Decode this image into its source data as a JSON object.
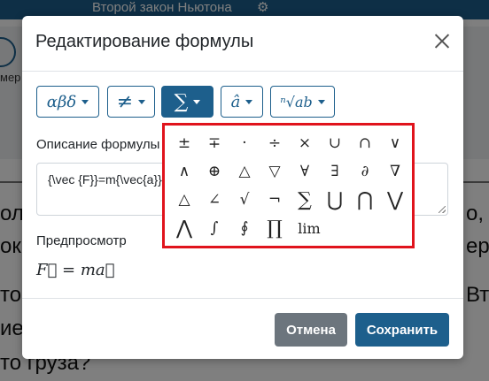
{
  "background": {
    "title": "Второй закон Ньютона",
    "side_text": "мер",
    "lines": [
      "ол",
      "ок",
      "то",
      "ие",
      "то груза?"
    ],
    "right_lines": [
      "о,",
      "ер",
      "Вт"
    ]
  },
  "modal": {
    "title": "Редактирование формулы",
    "toolbar": [
      {
        "label": "αβδ"
      },
      {
        "label": "≠"
      },
      {
        "label": "∑"
      },
      {
        "label": "â"
      },
      {
        "label": "ⁿ√ab"
      }
    ],
    "description_label": "Описание формулы",
    "formula_text": "{\\vec  {F}}=m{\\vec{a}}",
    "preview_label": "Предпросмотр",
    "preview_formula": "F⃗ = ma⃗",
    "cancel_label": "Отмена",
    "save_label": "Сохранить"
  },
  "symbols": [
    [
      "±",
      "∓",
      "·",
      "÷",
      "×",
      "∪",
      "∩",
      "∨"
    ],
    [
      "∧",
      "⊕",
      "△",
      "▽",
      "∀",
      "∃",
      "∂",
      "∇"
    ],
    [
      "△",
      "∠",
      "√",
      "¬",
      "∑",
      "⋃",
      "⋂",
      "⋁"
    ],
    [
      "⋀",
      "∫",
      "∮",
      "∏",
      "lim"
    ]
  ],
  "colors": {
    "primary": "#1d5f8c",
    "highlight_border": "#e0131c",
    "cancel": "#6c757d"
  }
}
